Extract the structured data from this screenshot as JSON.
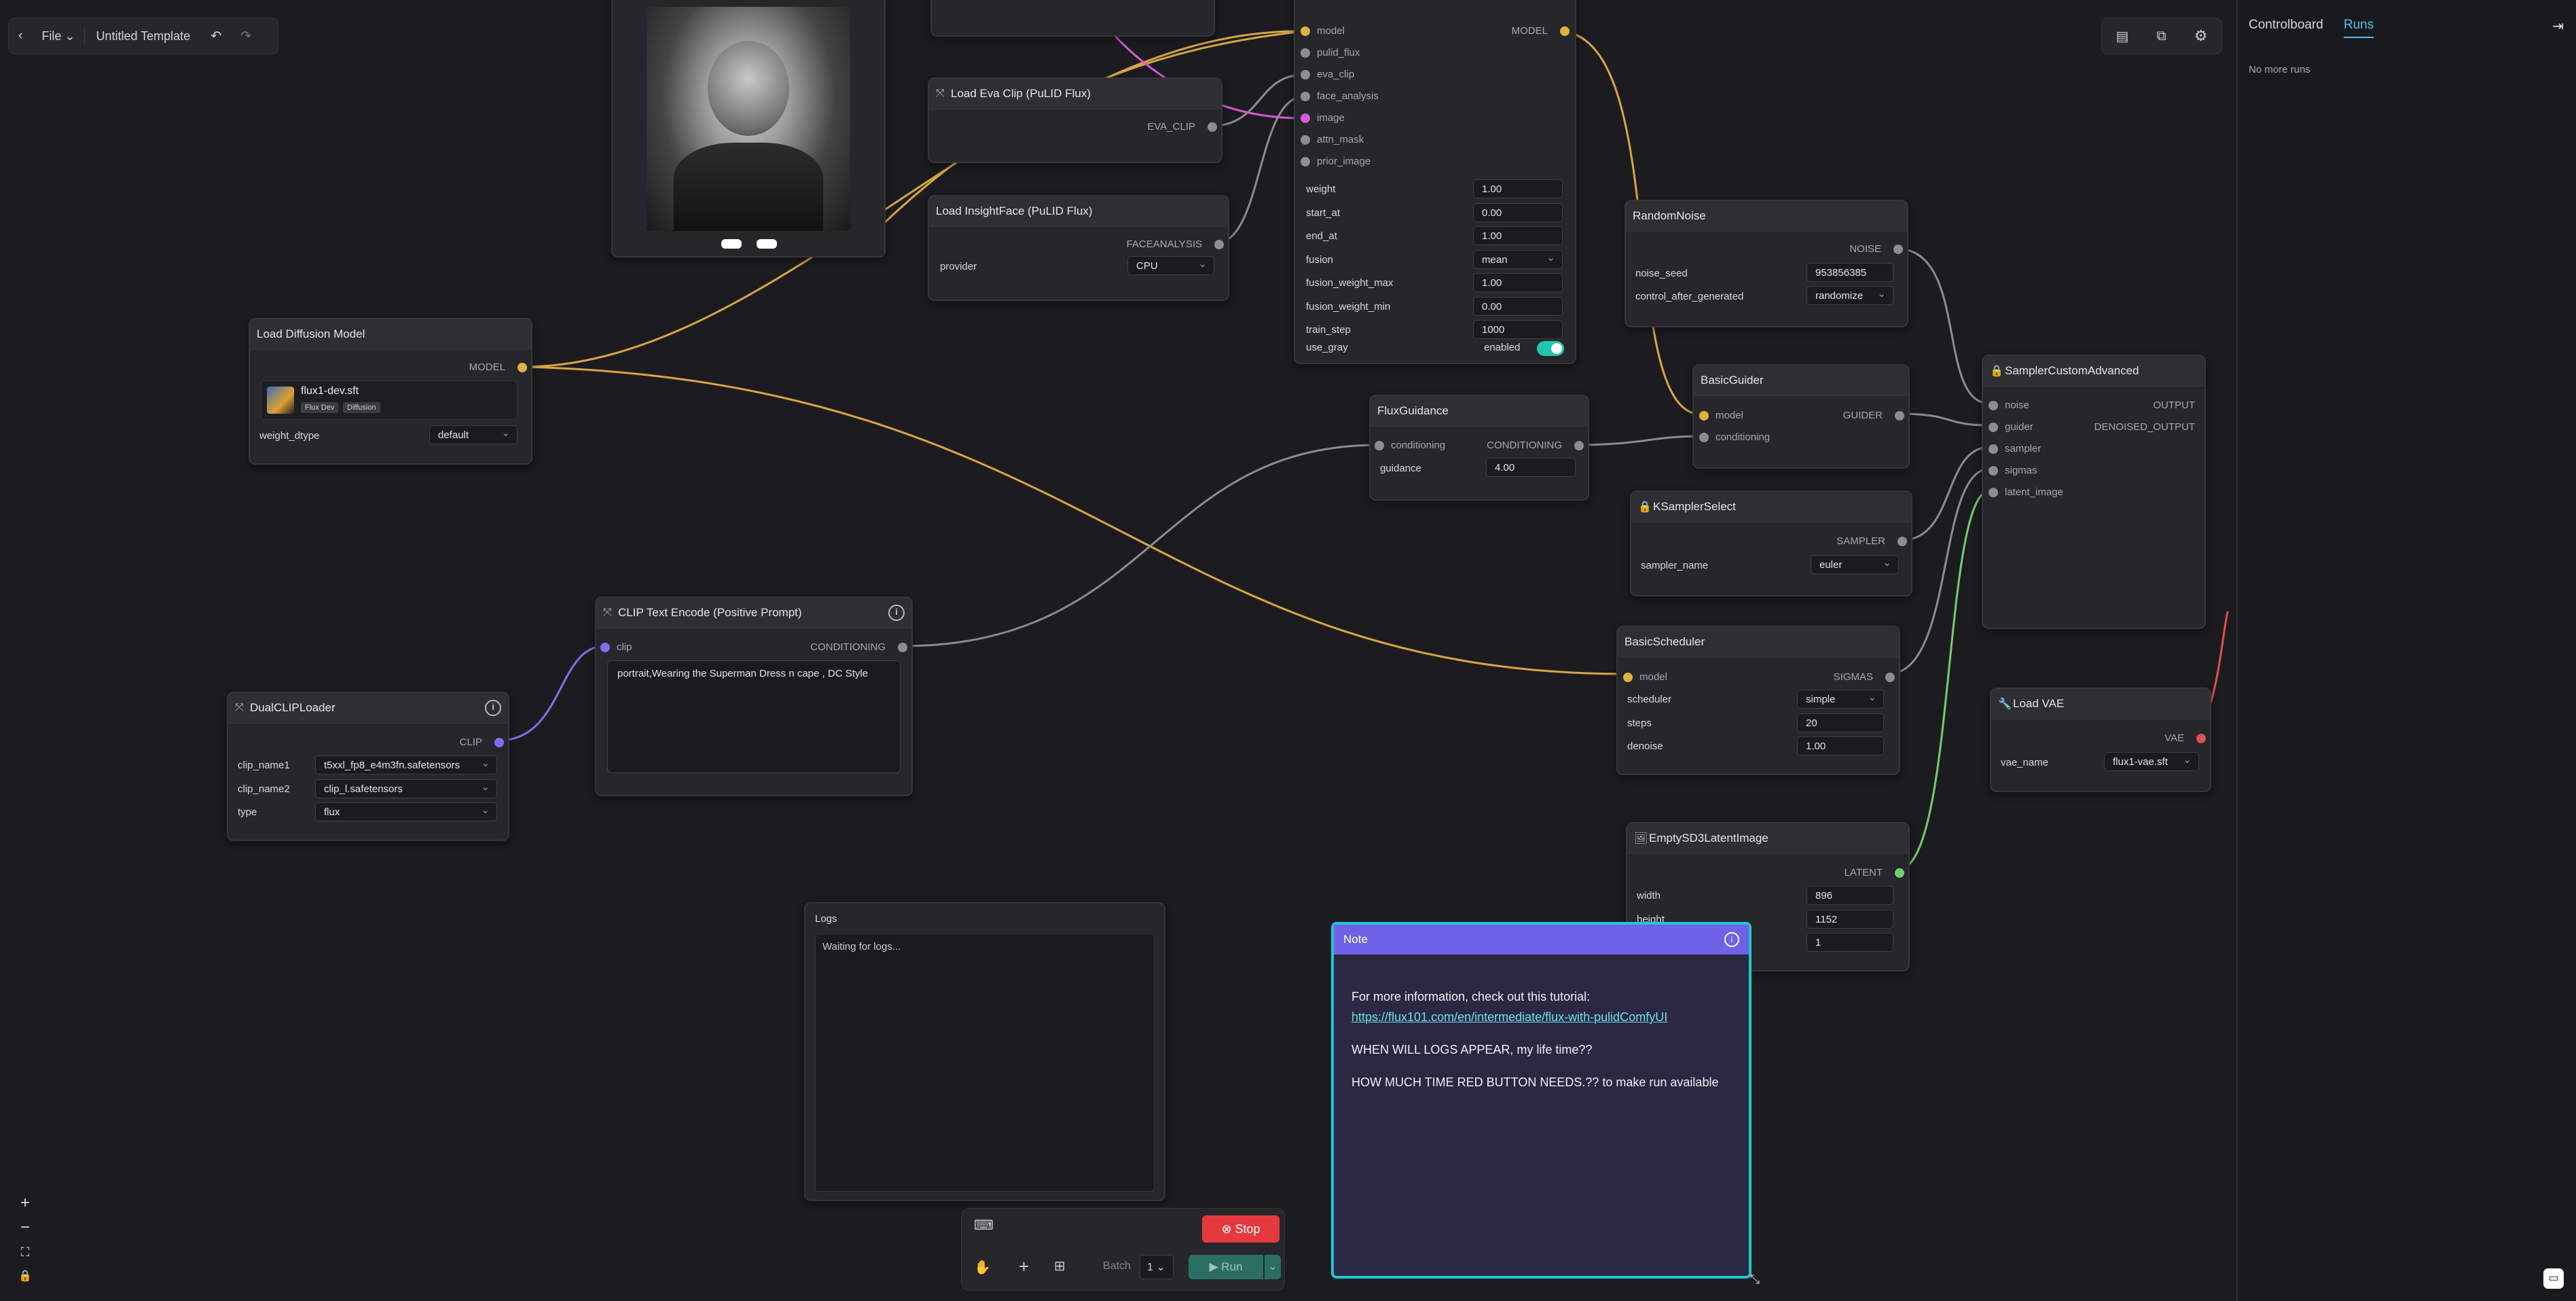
{
  "app": {
    "file_menu": "File",
    "template_title": "Untitled Template"
  },
  "panel": {
    "tabs": [
      "Controlboard",
      "Runs"
    ],
    "active_tab": "Runs",
    "empty_text": "No more runs"
  },
  "nodes": {
    "load_diffusion": {
      "title": "Load Diffusion Model",
      "out": "MODEL",
      "model_name": "flux1-dev.sft",
      "tags": [
        "Flux Dev",
        "Diffusion"
      ],
      "weight_dtype_label": "weight_dtype",
      "weight_dtype_value": "default"
    },
    "eva_clip": {
      "title": "Load Eva Clip (PuLID Flux)",
      "out": "EVA_CLIP"
    },
    "insightface": {
      "title": "Load InsightFace (PuLID Flux)",
      "out": "FACEANALYSIS",
      "provider_label": "provider",
      "provider_value": "CPU"
    },
    "pulid_apply": {
      "inputs": [
        "model",
        "pulid_flux",
        "eva_clip",
        "face_analysis",
        "image",
        "attn_mask",
        "prior_image"
      ],
      "out": "MODEL",
      "widgets": [
        {
          "label": "weight",
          "value": "1.00"
        },
        {
          "label": "start_at",
          "value": "0.00"
        },
        {
          "label": "end_at",
          "value": "1.00"
        },
        {
          "label": "fusion",
          "value": "mean"
        },
        {
          "label": "fusion_weight_max",
          "value": "1.00"
        },
        {
          "label": "fusion_weight_min",
          "value": "0.00"
        },
        {
          "label": "train_step",
          "value": "1000"
        }
      ],
      "use_gray_label": "use_gray",
      "use_gray_value": "enabled"
    },
    "random_noise": {
      "title": "RandomNoise",
      "out": "NOISE",
      "seed_label": "noise_seed",
      "seed_value": "953856385",
      "cag_label": "control_after_generated",
      "cag_value": "randomize"
    },
    "basic_guider": {
      "title": "BasicGuider",
      "out": "GUIDER",
      "inputs": [
        "model",
        "conditioning"
      ]
    },
    "flux_guidance": {
      "title": "FluxGuidance",
      "in": "conditioning",
      "out": "CONDITIONING",
      "guidance_label": "guidance",
      "guidance_value": "4.00"
    },
    "ksampler_select": {
      "title": "KSamplerSelect",
      "out": "SAMPLER",
      "sampler_label": "sampler_name",
      "sampler_value": "euler"
    },
    "sampler_custom": {
      "title": "SamplerCustomAdvanced",
      "inputs": [
        "noise",
        "guider",
        "sampler",
        "sigmas",
        "latent_image"
      ],
      "outputs": [
        "OUTPUT",
        "DENOISED_OUTPUT"
      ]
    },
    "basic_scheduler": {
      "title": "BasicScheduler",
      "in": "model",
      "out": "SIGMAS",
      "widgets": [
        {
          "label": "scheduler",
          "value": "simple"
        },
        {
          "label": "steps",
          "value": "20"
        },
        {
          "label": "denoise",
          "value": "1.00"
        }
      ]
    },
    "load_vae": {
      "title": "Load VAE",
      "out": "VAE",
      "vae_label": "vae_name",
      "vae_value": "flux1-vae.sft"
    },
    "empty_latent": {
      "title": "EmptySD3LatentImage",
      "out": "LATENT",
      "widgets": [
        {
          "label": "width",
          "value": "896"
        },
        {
          "label": "height",
          "value": "1152"
        },
        {
          "label": "",
          "value": "1"
        }
      ]
    },
    "clip_encode": {
      "title": "CLIP Text Encode (Positive Prompt)",
      "in": "clip",
      "out": "CONDITIONING",
      "prompt": "portrait,Wearing the Superman Dress n cape , DC Style"
    },
    "dual_clip": {
      "title": "DualCLIPLoader",
      "out": "CLIP",
      "widgets": [
        {
          "label": "clip_name1",
          "value": "t5xxl_fp8_e4m3fn.safetensors"
        },
        {
          "label": "clip_name2",
          "value": "clip_l.safetensors"
        },
        {
          "label": "type",
          "value": "flux"
        }
      ]
    },
    "logs": {
      "title": "Logs",
      "text": "Waiting for logs..."
    },
    "note": {
      "title": "Note",
      "line1": "For more information, check out this tutorial:",
      "link": "https://flux101.com/en/intermediate/flux-with-pulidComfyUI",
      "line2": "WHEN WILL LOGS APPEAR, my life time??",
      "line3": "HOW MUCH TIME RED BUTTON NEEDS.?? to make run available"
    }
  },
  "runbar": {
    "stop_label": "Stop",
    "batch_label": "Batch",
    "batch_value": "1",
    "run_label": "Run"
  },
  "colors": {
    "model_wire": "#d9a640",
    "clip_wire": "#7f6ff0",
    "image_wire": "#d85ad8",
    "latent_wire": "#6fce6f",
    "vae_wire": "#e05050",
    "accent": "#1ec7d1",
    "note_header": "#6f62e6",
    "stop": "#e5393f",
    "run": "#2b7d6d"
  }
}
